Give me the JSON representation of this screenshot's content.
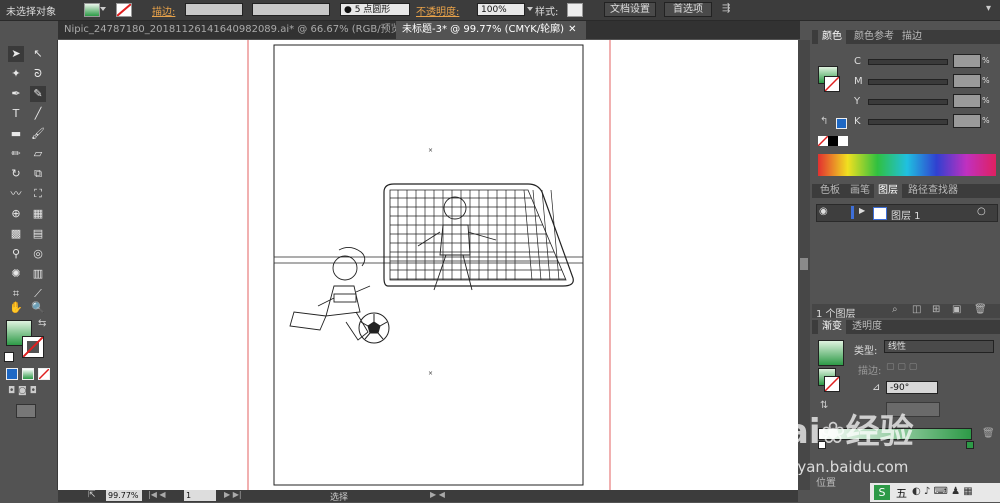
{
  "control_bar": {
    "selection_label": "未选择对象",
    "stroke_label": "描边:",
    "brush_label": "5 点圆形",
    "opacity_label": "不透明度:",
    "opacity_value": "100%",
    "style_label": "样式:",
    "doc_setup_button": "文档设置",
    "preferences_button": "首选项"
  },
  "tabs": [
    {
      "label": "Nipic_24787180_20181126141640982089.ai* @ 66.67% (RGB/预览)"
    },
    {
      "label": "未标题-3* @ 99.77% (CMYK/轮廓)"
    }
  ],
  "color_panel": {
    "tabs": [
      "颜色",
      "颜色参考",
      "描边"
    ],
    "channels": [
      "C",
      "M",
      "Y",
      "K"
    ],
    "unit": "%"
  },
  "layers_panel": {
    "tabs": [
      "色板",
      "画笔",
      "图层",
      "路径查找器"
    ],
    "layer_name": "图层 1",
    "count_label": "1 个图层"
  },
  "gradient_panel": {
    "tabs": [
      "渐变",
      "透明度"
    ],
    "type_label": "类型:",
    "type_value": "线性",
    "stroke_label": "描边:",
    "angle_value": "-90°",
    "position_label": "位置"
  },
  "status_bar": {
    "zoom": "99.77%",
    "page": "1",
    "mode": "选择"
  },
  "watermark": {
    "brand": "Bai",
    "brand2": "经验",
    "url": "jingyan.baidu.com"
  },
  "taskbar": {
    "ime": "五"
  },
  "colors": {
    "accent_green": "#2d9a47",
    "ui_dark": "#3c3c3c",
    "panel": "#535353",
    "guide_red": "#e36060"
  }
}
